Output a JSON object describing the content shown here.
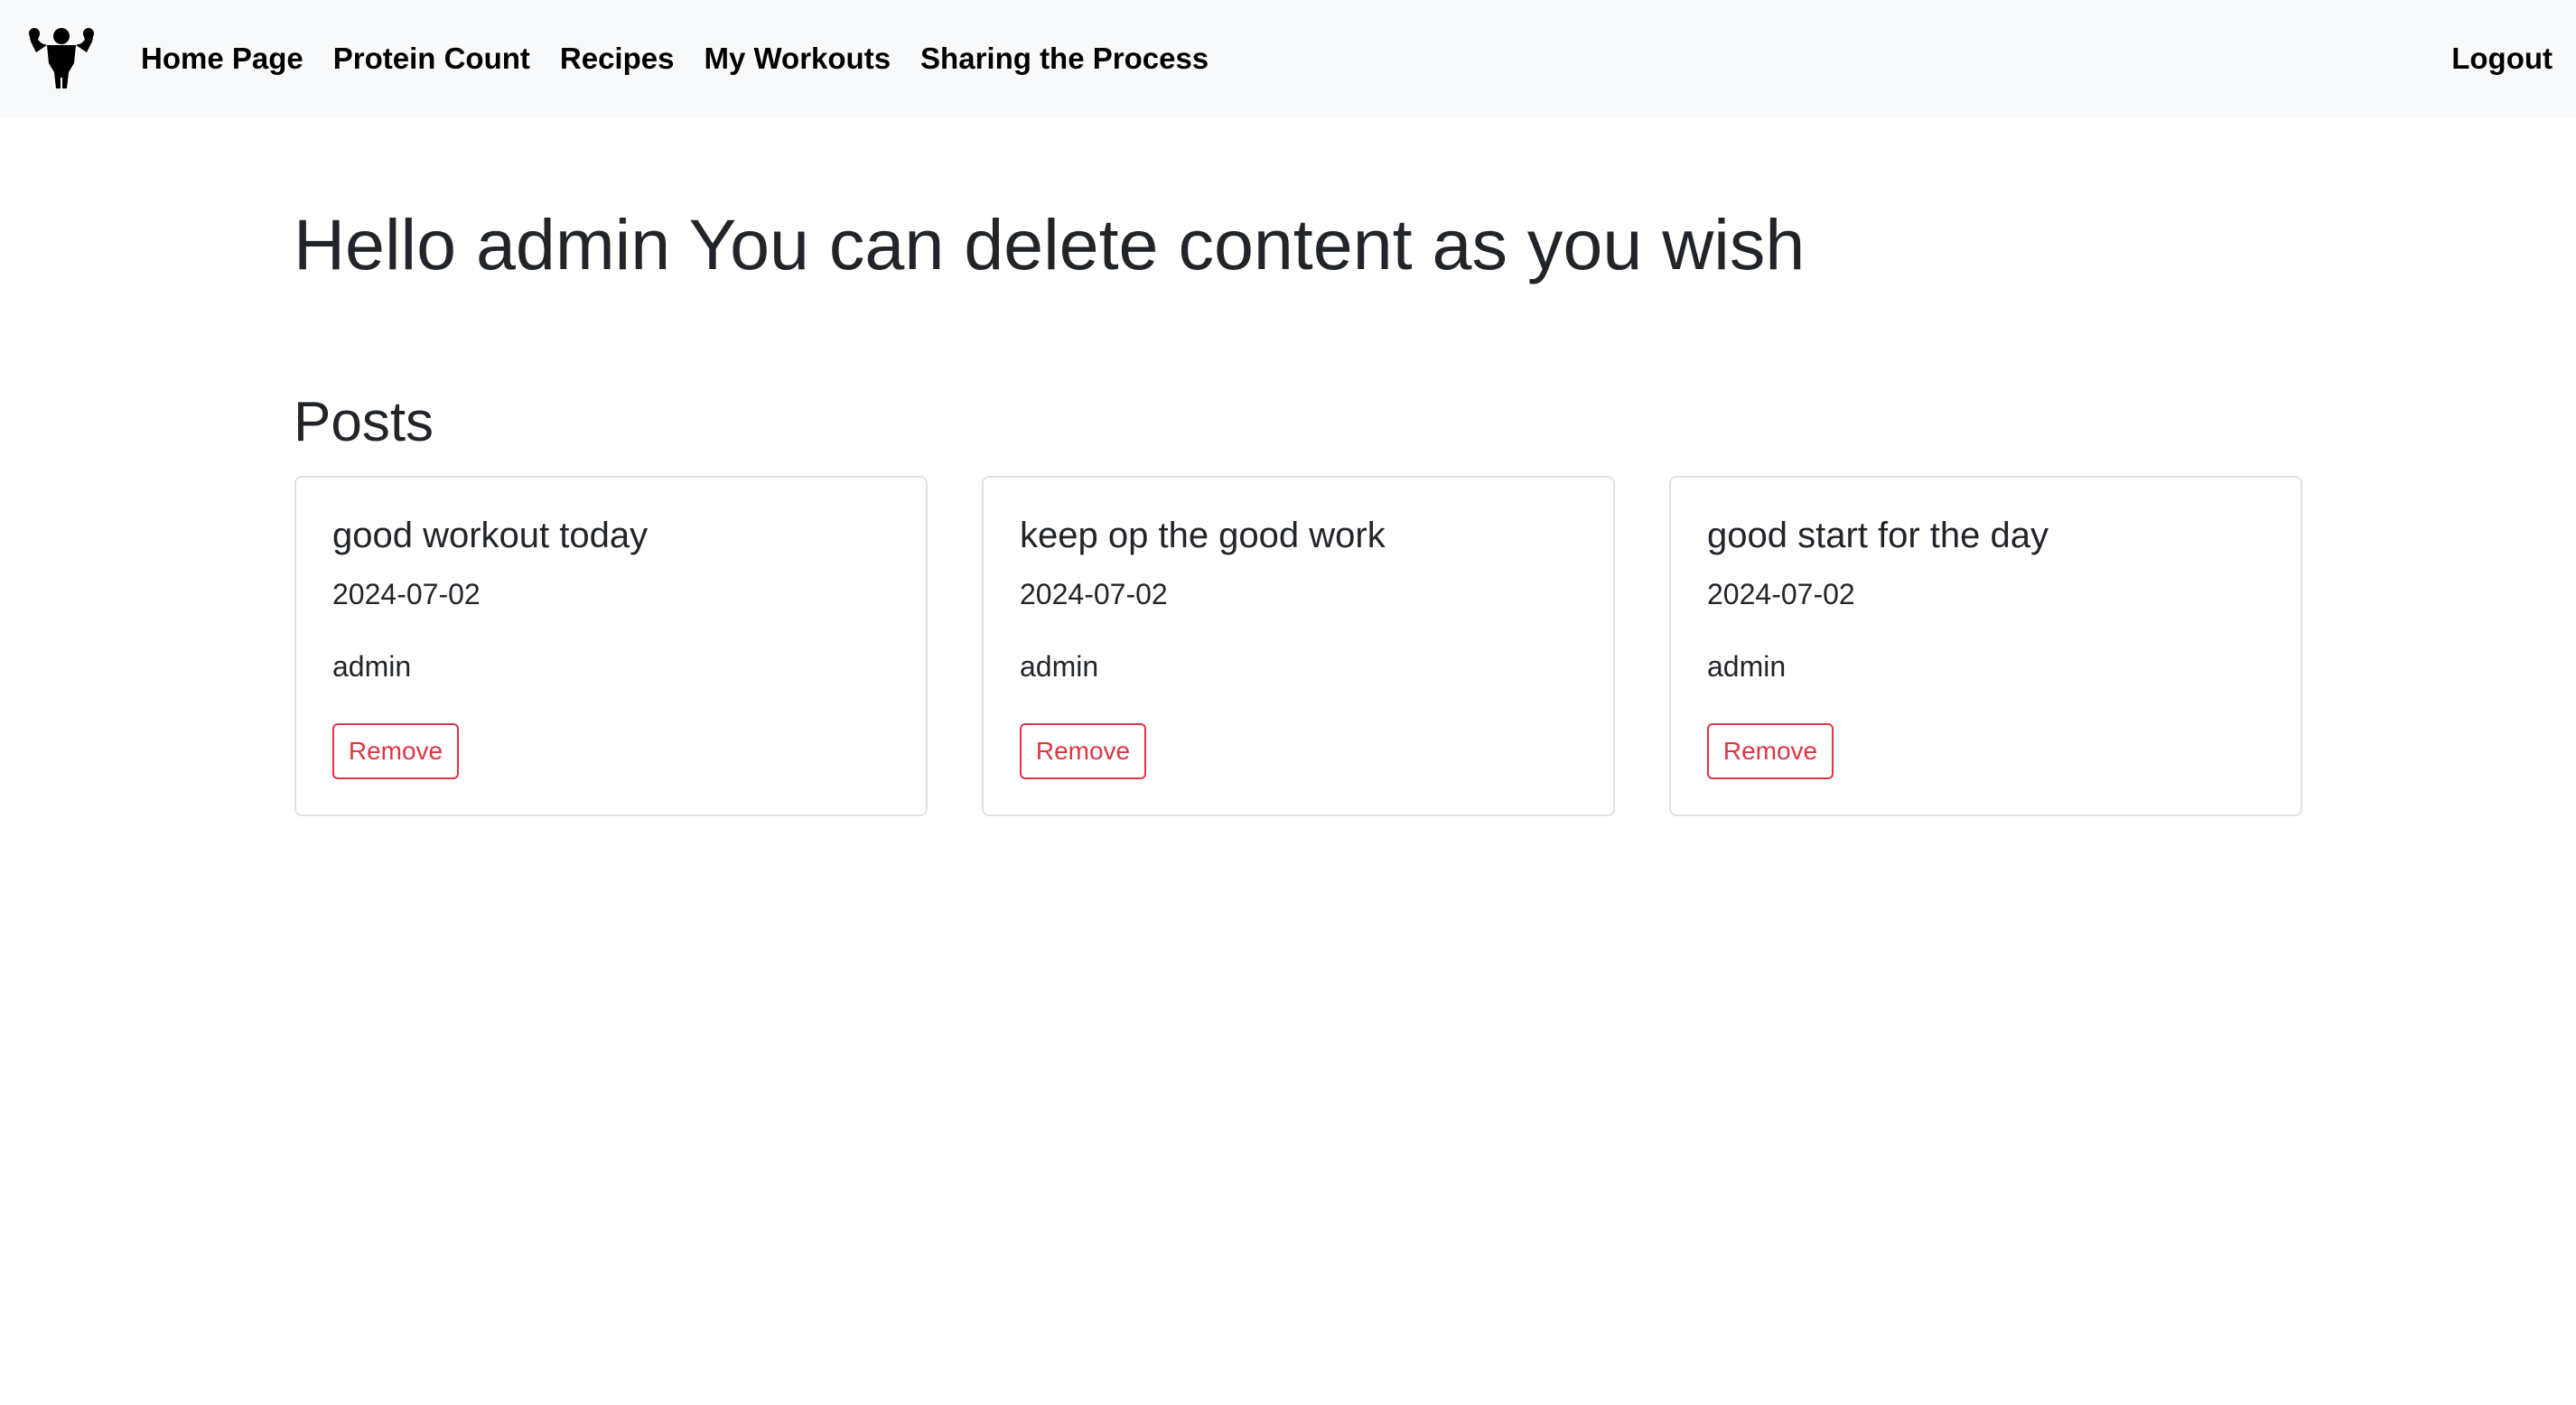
{
  "brand": {
    "icon": "bodybuilder-flex-icon"
  },
  "nav": {
    "items": [
      {
        "label": "Home Page"
      },
      {
        "label": "Protein Count"
      },
      {
        "label": "Recipes"
      },
      {
        "label": "My Workouts"
      },
      {
        "label": "Sharing the Process"
      }
    ],
    "logout_label": "Logout"
  },
  "main": {
    "title": "Hello admin You can delete content as you wish",
    "posts_heading": "Posts",
    "posts": [
      {
        "title": "good workout today",
        "date": "2024-07-02",
        "author": "admin",
        "remove_label": "Remove"
      },
      {
        "title": "keep op the good work",
        "date": "2024-07-02",
        "author": "admin",
        "remove_label": "Remove"
      },
      {
        "title": "good start for the day",
        "date": "2024-07-02",
        "author": "admin",
        "remove_label": "Remove"
      }
    ]
  },
  "colors": {
    "navbar_bg": "#f8f9fa",
    "danger": "#dc3545",
    "text": "#212529",
    "card_border": "#dee2e6"
  }
}
